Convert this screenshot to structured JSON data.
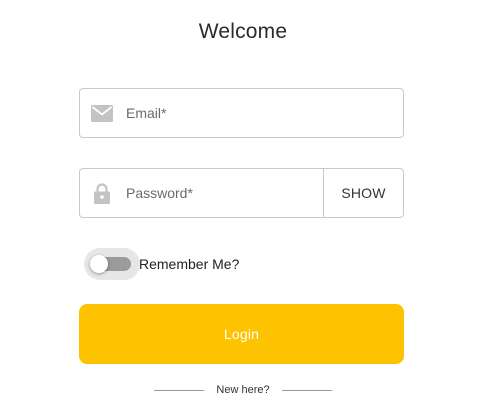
{
  "header": {
    "title": "Welcome"
  },
  "form": {
    "email": {
      "placeholder": "Email*",
      "value": "",
      "icon": "mail-icon"
    },
    "password": {
      "placeholder": "Password*",
      "value": "",
      "icon": "lock-icon",
      "show_label": "SHOW"
    },
    "remember": {
      "label": "Remember Me?",
      "checked": false
    },
    "login_label": "Login"
  },
  "footer": {
    "new_here": "New here?"
  },
  "colors": {
    "accent": "#fdc300",
    "border": "#c9c9c9",
    "icon": "#c3c3c3",
    "toggle_track": "#9b9b9b"
  }
}
